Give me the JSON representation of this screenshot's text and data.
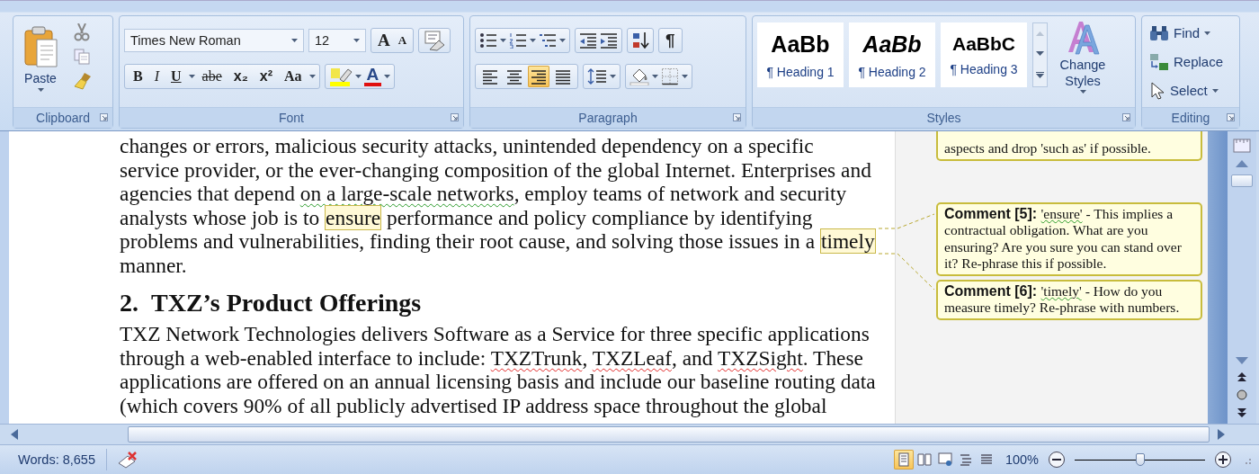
{
  "ribbon": {
    "clipboard": {
      "paste": "Paste",
      "title": "Clipboard"
    },
    "font": {
      "font_name": "Times New Roman",
      "font_size": "12",
      "grow": "A",
      "shrink": "A",
      "format_buttons": [
        {
          "kind": "bold",
          "label": "B"
        },
        {
          "kind": "italic",
          "label": "I"
        },
        {
          "kind": "underline",
          "label": "U"
        },
        {
          "kind": "strike",
          "label": "abe"
        },
        {
          "kind": "sub",
          "label": "x₂"
        },
        {
          "kind": "sup",
          "label": "x²"
        },
        {
          "kind": "case",
          "label": "Aa"
        }
      ],
      "font_color": "A",
      "title": "Font"
    },
    "paragraph": {
      "show_marks": "¶",
      "align_buttons": [
        {
          "kind": "left",
          "selected": false
        },
        {
          "kind": "center",
          "selected": false
        },
        {
          "kind": "right",
          "selected": true
        },
        {
          "kind": "justify",
          "selected": false
        }
      ],
      "title": "Paragraph"
    },
    "styles": {
      "gallery": [
        {
          "kind": "bold",
          "preview": "AaBb",
          "label": "¶ Heading 1"
        },
        {
          "kind": "bold-italic",
          "preview": "AaBb",
          "label": "¶ Heading 2"
        },
        {
          "kind": "bold-small",
          "preview": "AaBbC",
          "label": "¶ Heading 3"
        }
      ],
      "change_styles": "Change Styles",
      "title": "Styles"
    },
    "editing": {
      "find": "Find",
      "replace": "Replace",
      "select": "Select",
      "title": "Editing"
    }
  },
  "document": {
    "blocks": [
      {
        "kind": "body",
        "lines": [
          [
            {
              "text": "changes or errors, malicious security attacks, unintended dependency on a specific"
            }
          ],
          [
            {
              "text": "service provider, or the ever-changing composition of the global Internet. Enterprises and"
            }
          ],
          [
            {
              "text": "agencies that depend "
            },
            {
              "text": "on a large-scale networks",
              "kind": "grammar"
            },
            {
              "text": ", employ teams of network and security"
            }
          ],
          [
            {
              "text": "analysts whose job is to "
            },
            {
              "text": "ensure",
              "kind": "comment"
            },
            {
              "text": " performance and policy compliance by identifying"
            }
          ],
          [
            {
              "text": "problems and vulnerabilities, finding their root cause, and solving those issues in a "
            },
            {
              "text": "timely",
              "kind": "comment"
            }
          ],
          [
            {
              "text": "manner."
            }
          ]
        ]
      },
      {
        "kind": "heading",
        "number": "2.",
        "text": "TXZ’s Product Offerings"
      },
      {
        "kind": "body",
        "lines": [
          [
            {
              "text": "TXZ Network Technologies delivers Software as a Service for three specific applications"
            }
          ],
          [
            {
              "text": "through a web-enabled interface to include: "
            },
            {
              "text": "TXZTrunk",
              "kind": "spelling"
            },
            {
              "text": ", "
            },
            {
              "text": "TXZLeaf",
              "kind": "spelling"
            },
            {
              "text": ", and "
            },
            {
              "text": "TXZSight",
              "kind": "spelling"
            },
            {
              "text": ". These"
            }
          ],
          [
            {
              "text": "applications are offered on an annual licensing basis and include our baseline routing data"
            }
          ],
          [
            {
              "text": "(which covers 90% of all publicly advertised IP address space throughout the global"
            }
          ]
        ]
      }
    ]
  },
  "comments": [
    {
      "kind": "partial",
      "text": "aspects and drop 'such as' if possible."
    },
    {
      "kind": "full",
      "label": "Comment [5]:",
      "quote": "'ensure'",
      "text": " - This implies a contractual obligation. What are you ensuring? Are you sure you can stand over it? Re-phrase this if possible."
    },
    {
      "kind": "full",
      "label": "Comment [6]:",
      "quote": "'timely'",
      "text": " - How do you measure timely? Re-phrase with numbers."
    }
  ],
  "status_bar": {
    "words": "Words: 8,655",
    "views": [
      {
        "selected": true
      },
      {
        "selected": false
      },
      {
        "selected": false
      },
      {
        "selected": false
      },
      {
        "selected": false
      }
    ],
    "zoom": "100%",
    "zoom_slider": {
      "level": 0.5
    }
  }
}
